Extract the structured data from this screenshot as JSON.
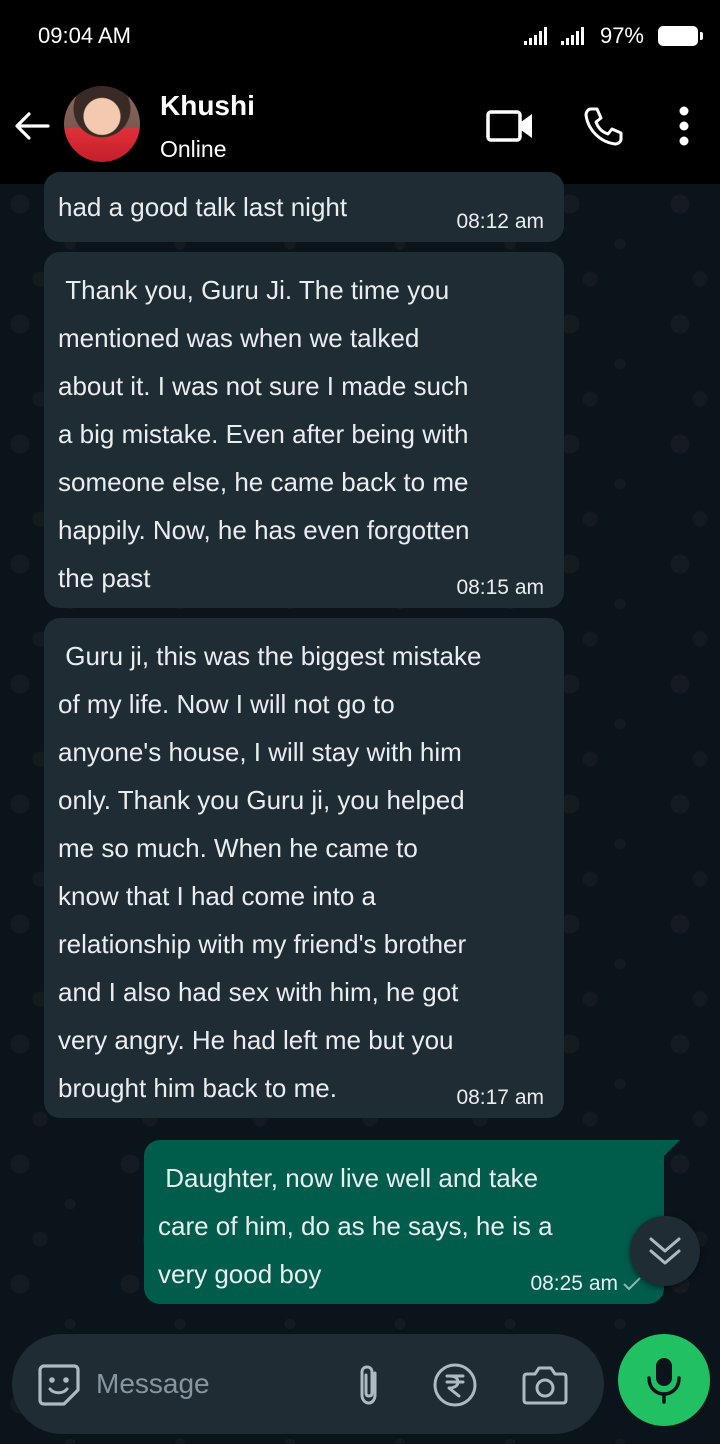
{
  "status_bar": {
    "time": "09:04 AM",
    "battery": "97%"
  },
  "header": {
    "contact_name": "Khushi",
    "contact_status": "Online"
  },
  "messages": [
    {
      "direction": "in",
      "text": "had a good talk last night",
      "time": "08:12 am"
    },
    {
      "direction": "in",
      "text": " Thank you, Guru Ji. The time you\nmentioned was when we talked\nabout it. I was not sure I made such\na big mistake. Even after being with\nsomeone else, he came back to me\nhappily. Now, he has even forgotten\nthe past",
      "time": "08:15 am"
    },
    {
      "direction": "in",
      "text": " Guru ji, this was the biggest mistake\nof my life. Now I will not go to\nanyone's house, I will stay with him\nonly. Thank you Guru ji, you helped\nme so much. When he came to\nknow that I had come into a\nrelationship with my friend's brother\nand I also had sex with him, he got\nvery angry. He had left me but you\nbrought him back to me.",
      "time": "08:17 am"
    },
    {
      "direction": "out",
      "text": " Daughter, now live well and take\ncare of him, do as he says, he is a\nvery good boy",
      "time": "08:25 am"
    }
  ],
  "composer": {
    "placeholder": "Message"
  },
  "icons": {
    "back": "arrow-left-icon",
    "video": "video-call-icon",
    "call": "phone-icon",
    "menu": "more-vert-icon",
    "sticker": "sticker-icon",
    "attach": "paperclip-icon",
    "payment": "rupee-icon",
    "camera": "camera-icon",
    "mic": "mic-icon",
    "scroll": "double-chevron-down-icon",
    "tick": "check-icon"
  },
  "colors": {
    "incoming_bubble": "#202c33",
    "outgoing_bubble": "#005c4b",
    "mic_button": "#21c063",
    "background": "#0b141a"
  }
}
